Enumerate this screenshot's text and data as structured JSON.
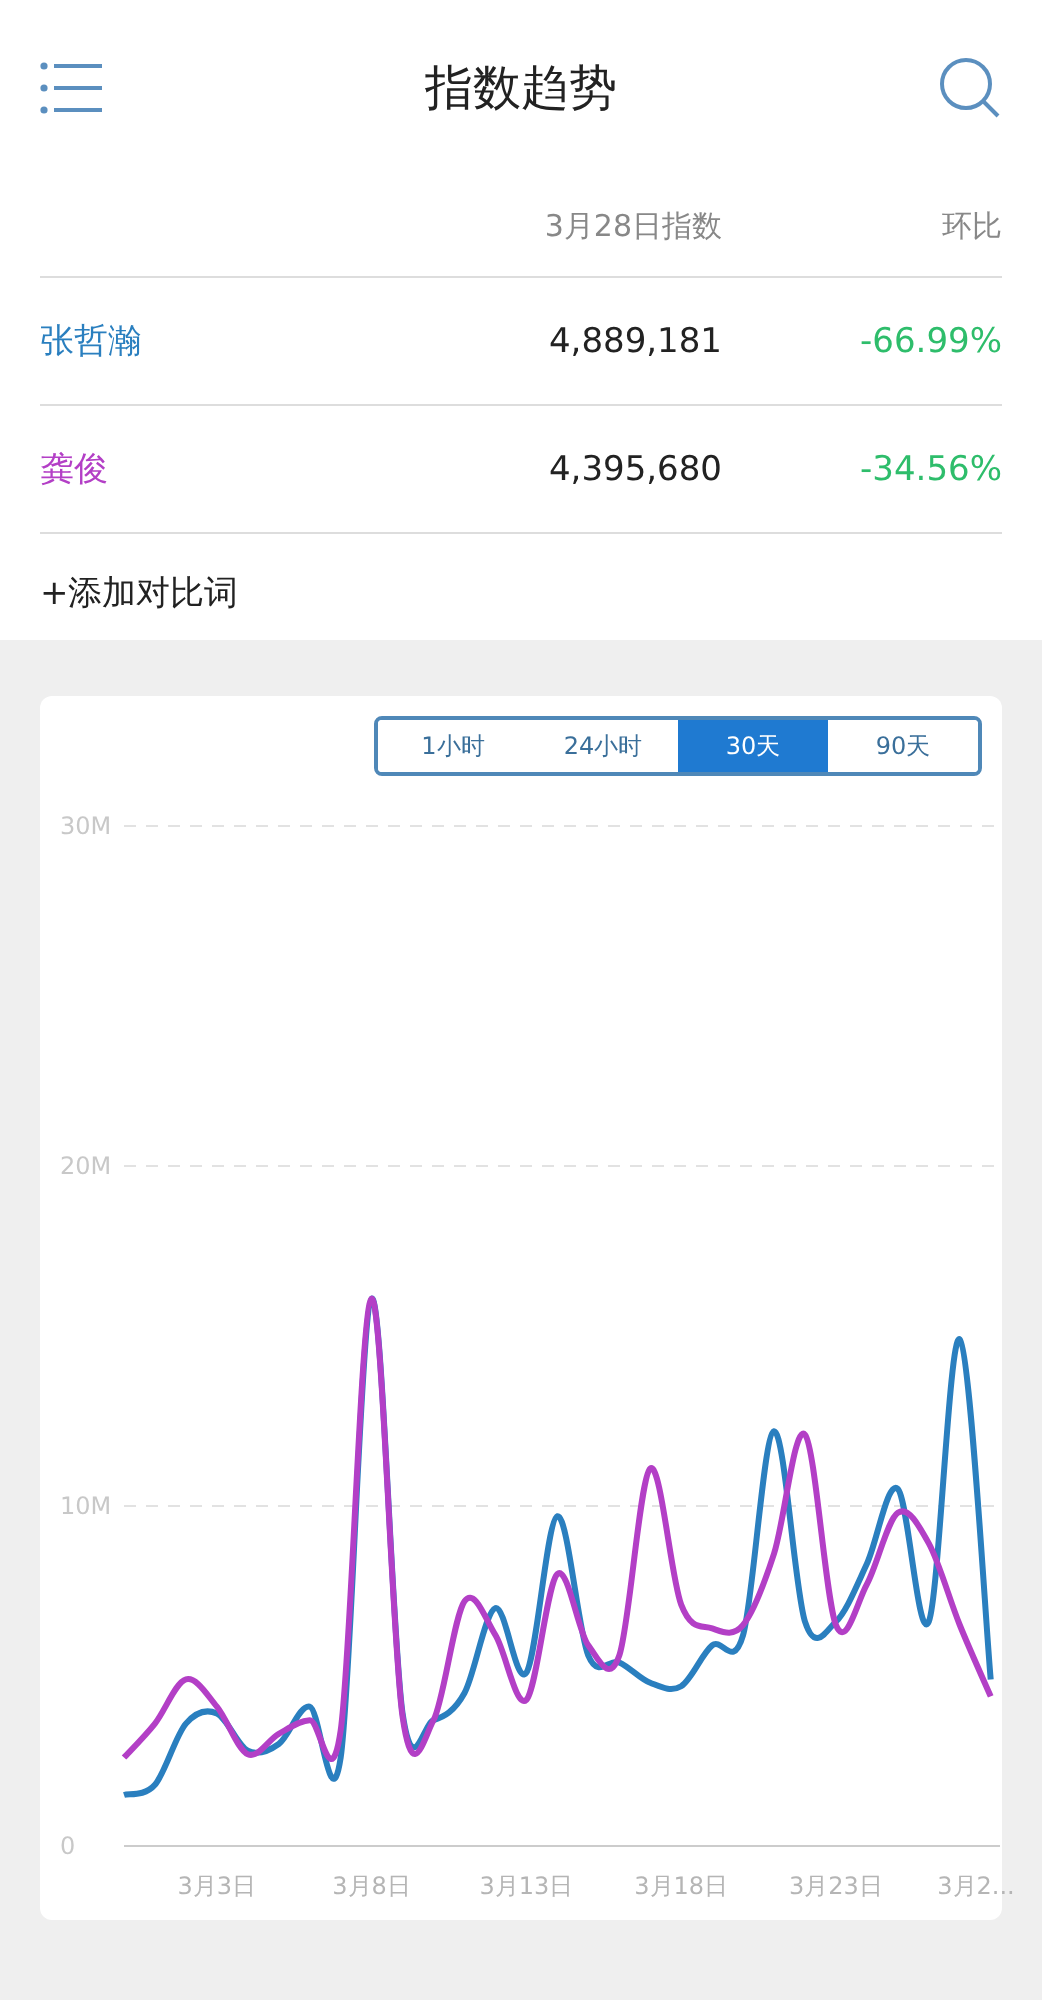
{
  "header": {
    "title": "指数趋势"
  },
  "table": {
    "columns": [
      "3月28日指数",
      "环比"
    ],
    "rows": [
      {
        "name": "张哲瀚",
        "color": "#2a7fbf",
        "index": "4,889,181",
        "change": "-66.99%"
      },
      {
        "name": "龚俊",
        "color": "#b33fc6",
        "index": "4,395,680",
        "change": "-34.56%"
      }
    ]
  },
  "add_term": "+添加对比词",
  "ranges": [
    {
      "label": "1小时",
      "selected": false
    },
    {
      "label": "24小时",
      "selected": false
    },
    {
      "label": "30天",
      "selected": true
    },
    {
      "label": "90天",
      "selected": false
    }
  ],
  "chart_data": {
    "type": "line",
    "categories": [
      null,
      null,
      null,
      "3月3日",
      null,
      null,
      null,
      null,
      "3月8日",
      null,
      null,
      null,
      null,
      "3月13日",
      null,
      null,
      null,
      null,
      "3月18日",
      null,
      null,
      null,
      null,
      "3月23日",
      null,
      null,
      null,
      null,
      "3月2..."
    ],
    "yticks": [
      {
        "value": 0,
        "label": "0"
      },
      {
        "value": 10,
        "label": "10M"
      },
      {
        "value": 20,
        "label": "20M"
      },
      {
        "value": 30,
        "label": "30M"
      }
    ],
    "ylim": [
      0,
      30
    ],
    "series": [
      {
        "color": "#2a7fbf",
        "values": [
          1.5,
          1.8,
          3.6,
          3.9,
          2.8,
          3.0,
          4.1,
          2.6,
          16.1,
          3.9,
          3.7,
          4.5,
          7.0,
          5.1,
          9.7,
          5.6,
          5.4,
          4.8,
          4.7,
          5.9,
          6.2,
          12.2,
          6.6,
          6.6,
          8.3,
          10.5,
          6.6,
          14.9,
          4.9
        ]
      },
      {
        "color": "#b33fc6",
        "values": [
          2.6,
          3.6,
          4.9,
          4.1,
          2.7,
          3.3,
          3.7,
          3.4,
          16.1,
          3.8,
          3.7,
          7.2,
          6.2,
          4.3,
          8.0,
          5.9,
          5.6,
          11.1,
          7.1,
          6.4,
          6.5,
          8.6,
          12.1,
          6.5,
          7.7,
          9.8,
          8.9,
          6.5,
          4.4
        ]
      }
    ]
  }
}
